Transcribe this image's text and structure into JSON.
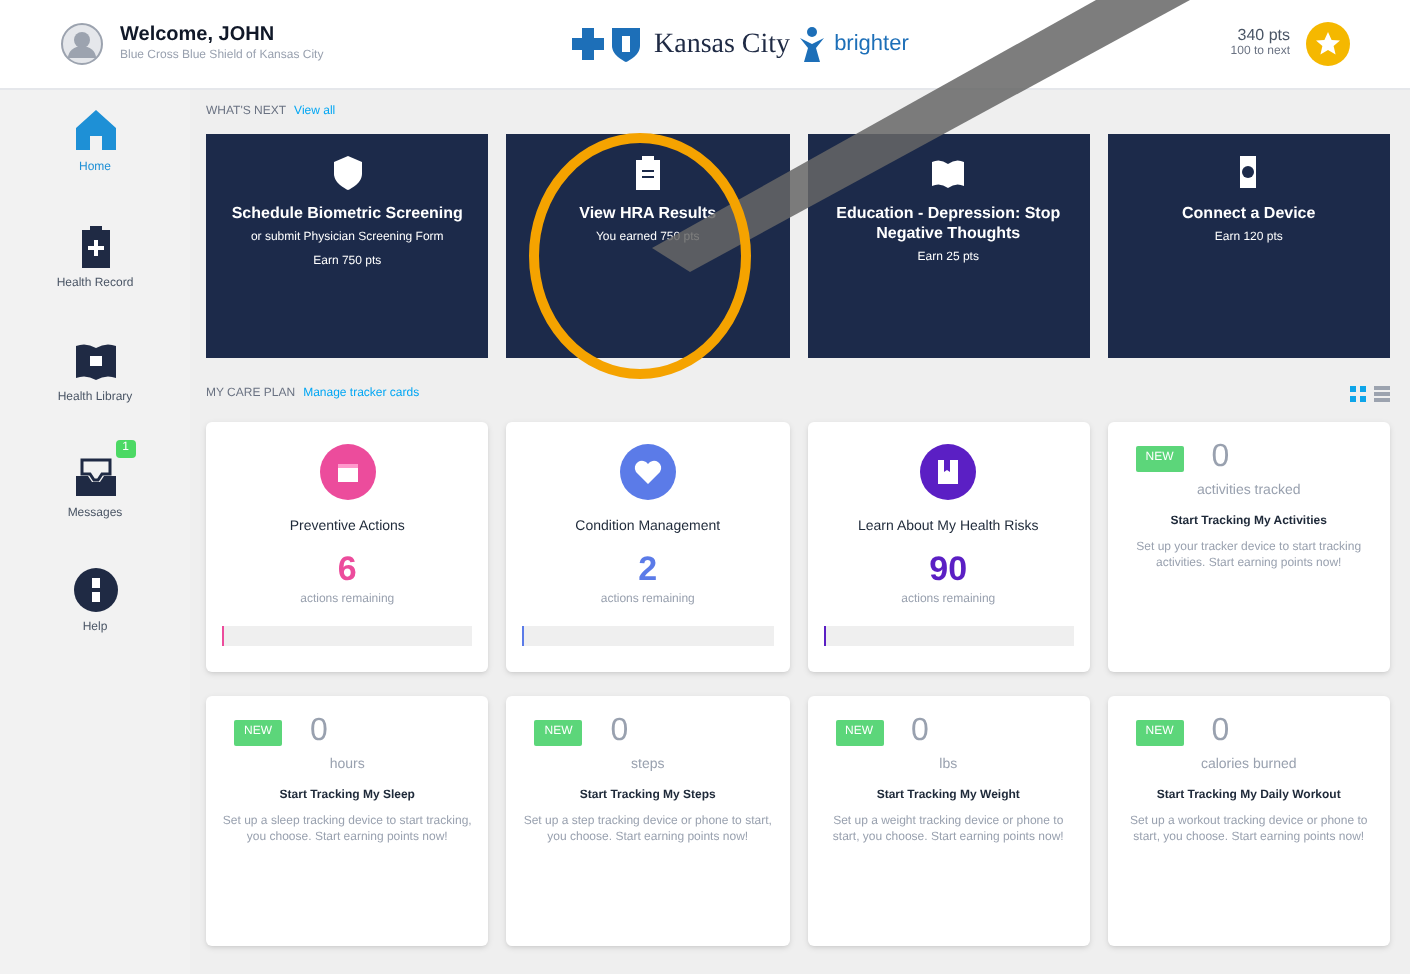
{
  "header": {
    "greeting": "Welcome, JOHN",
    "subtitle": "Blue Cross Blue Shield of Kansas City",
    "brand_text": "Kansas City",
    "brand_partner": "brighter",
    "points": "340 pts",
    "points_sub": "100 to next"
  },
  "sidebar": {
    "items": [
      {
        "label": "Home",
        "selected": true
      },
      {
        "label": "Health Record",
        "selected": false
      },
      {
        "label": "Health Library",
        "selected": false
      },
      {
        "label": "Messages",
        "selected": false,
        "badge": "1"
      },
      {
        "label": "Help",
        "selected": false
      }
    ]
  },
  "whats_next": {
    "heading": "WHAT'S NEXT",
    "link": "View all",
    "cards": [
      {
        "title": "Schedule Biometric Screening",
        "lines": [
          "or submit Physician Screening Form",
          "Earn 750 pts"
        ]
      },
      {
        "title": "View HRA Results",
        "lines": [
          "You earned 750 pts"
        ]
      },
      {
        "title": "Education - Depression: Stop Negative Thoughts",
        "lines": [
          "Earn 25 pts"
        ]
      },
      {
        "title": "Connect a Device",
        "lines": [
          "Earn 120 pts"
        ]
      }
    ]
  },
  "care_plan": {
    "heading": "MY CARE PLAN",
    "link": "Manage tracker cards",
    "cards": [
      {
        "kind": "plan",
        "color": "#ec4c9c",
        "title": "Preventive Actions",
        "count": "6",
        "caption": "actions remaining",
        "level": 0
      },
      {
        "kind": "plan",
        "color": "#5b7be8",
        "title": "Condition Management",
        "count": "2",
        "caption": "actions remaining",
        "level": 0
      },
      {
        "kind": "plan",
        "color": "#5b1fc4",
        "title": "Learn About My Health Risks",
        "count": "90",
        "caption": "actions remaining",
        "level": 0.01
      },
      {
        "kind": "tracker",
        "badge": "NEW",
        "count": "0",
        "unit": "activities tracked",
        "title": "Start Tracking My Activities",
        "desc": "Set up your tracker device to start tracking activities. Start earning points now!"
      },
      {
        "kind": "tracker",
        "badge": "NEW",
        "count": "0",
        "unit": "hours",
        "title": "Start Tracking My Sleep",
        "desc": "Set up a sleep tracking device to start tracking, you choose. Start earning points now!"
      },
      {
        "kind": "tracker",
        "badge": "NEW",
        "count": "0",
        "unit": "steps",
        "title": "Start Tracking My Steps",
        "desc": "Set up a step tracking device or phone to start, you choose. Start earning points now!"
      },
      {
        "kind": "tracker",
        "badge": "NEW",
        "count": "0",
        "unit": "lbs",
        "title": "Start Tracking My Weight",
        "desc": "Set up a weight tracking device or phone to start, you choose. Start earning points now!"
      },
      {
        "kind": "tracker",
        "badge": "NEW",
        "count": "0",
        "unit": "calories burned",
        "title": "Start Tracking My Daily Workout",
        "desc": "Set up a workout tracking device or phone to start, you choose. Start earning points now!"
      }
    ]
  }
}
